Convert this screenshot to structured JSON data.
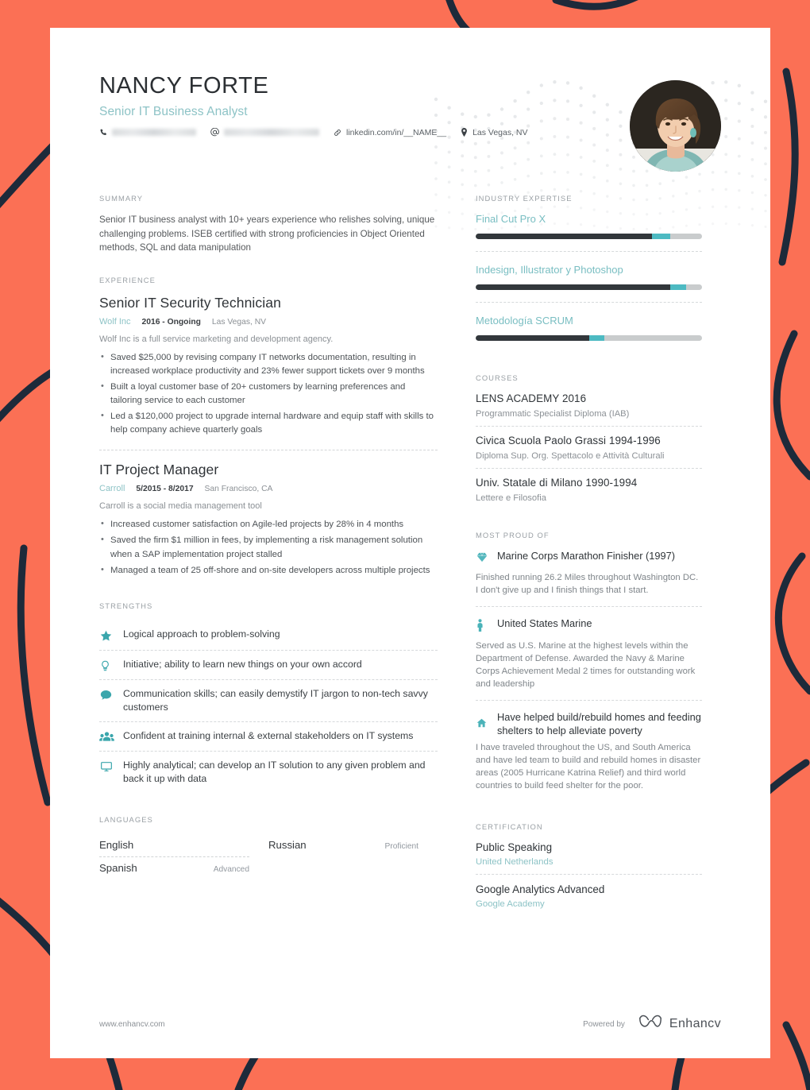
{
  "theme": {
    "page_bg": "#fb7055",
    "paper": "#ffffff",
    "teal": "#8dc3c6",
    "icon_teal": "#3aa6ac",
    "dark": "#32373b",
    "bar_track": "#c9cccd",
    "bar_mid": "#4dbac2"
  },
  "header": {
    "name": "NANCY FORTE",
    "role": "Senior IT Business Analyst",
    "contacts": [
      {
        "icon": "phone-icon",
        "value": "",
        "redacted": true
      },
      {
        "icon": "email-icon",
        "value": "",
        "redacted": true
      },
      {
        "icon": "link-icon",
        "value": "linkedin.com/in/__NAME__",
        "redacted": false
      },
      {
        "icon": "location-pin-icon",
        "value": "Las Vegas, NV",
        "redacted": false
      }
    ]
  },
  "left": {
    "summary": {
      "label": "SUMMARY",
      "text": "Senior IT business analyst with 10+ years experience who relishes solving, unique challenging problems. ISEB certified with strong proficiencies in Object Oriented methods, SQL and data manipulation"
    },
    "experience": {
      "label": "EXPERIENCE",
      "jobs": [
        {
          "title": "Senior IT Security Technician",
          "company": "Wolf Inc",
          "dates": "2016 - Ongoing",
          "location": "Las Vegas, NV",
          "description": "Wolf Inc is a full service marketing and development agency.",
          "bullets": [
            "Saved $25,000 by revising company IT networks documentation, resulting in increased workplace productivity and 23% fewer support tickets over 9 months",
            "Built a loyal customer base of 20+ customers by learning preferences and tailoring service to each customer",
            "Led a $120,000 project to upgrade internal hardware and equip staff with skills to help company achieve quarterly goals"
          ]
        },
        {
          "title": "IT Project Manager",
          "company": "Carroll",
          "dates": "5/2015 - 8/2017",
          "location": "San Francisco, CA",
          "description": "Carroll is a social media management tool",
          "bullets": [
            "Increased customer satisfaction on Agile-led projects by 28% in 4 months",
            "Saved the firm $1 million in fees, by implementing a risk management solution when a SAP implementation project stalled",
            "Managed a team of 25 off-shore and on-site developers across multiple projects"
          ]
        }
      ]
    },
    "strengths": {
      "label": "STRENGTHS",
      "items": [
        {
          "icon": "star-icon",
          "text": "Logical approach to problem-solving"
        },
        {
          "icon": "lightbulb-icon",
          "text": "Initiative; ability to learn new things on your own accord"
        },
        {
          "icon": "chat-bubble-icon",
          "text": "Communication skills; can easily demystify IT jargon to non-tech savvy customers"
        },
        {
          "icon": "people-group-icon",
          "text": "Confident at training internal & external stakeholders on IT systems"
        },
        {
          "icon": "monitor-icon",
          "text": "Highly analytical; can develop an IT solution to any given problem and back it up with data"
        }
      ]
    },
    "languages": {
      "label": "LANGUAGES",
      "items": [
        {
          "name": "English",
          "level": ""
        },
        {
          "name": "Spanish",
          "level": "Advanced"
        },
        {
          "name": "Russian",
          "level": "Proficient"
        }
      ]
    }
  },
  "right": {
    "industry_expertise": {
      "label": "INDUSTRY EXPERTISE",
      "skills": [
        {
          "name": "Final Cut Pro X",
          "dark_pct": 78,
          "mid_pct": 8
        },
        {
          "name": "Indesign, Illustrator y Photoshop",
          "dark_pct": 86,
          "mid_pct": 7
        },
        {
          "name": "Metodología SCRUM",
          "dark_pct": 50,
          "mid_pct": 7
        }
      ]
    },
    "courses": {
      "label": "COURSES",
      "items": [
        {
          "name": "LENS ACADEMY 2016",
          "sub": "Programmatic Specialist Diploma (IAB)"
        },
        {
          "name": "Civica Scuola Paolo Grassi 1994-1996",
          "sub": "Diploma Sup. Org. Spettacolo e Attività Culturali"
        },
        {
          "name": "Univ. Statale di Milano 1990-1994",
          "sub": "Lettere e Filosofia"
        }
      ]
    },
    "most_proud_of": {
      "label": "MOST PROUD OF",
      "items": [
        {
          "icon": "diamond-icon",
          "title": "Marine Corps Marathon Finisher (1997)",
          "text": "Finished running 26.2 Miles throughout Washington DC. I don't give up and I finish things that I start."
        },
        {
          "icon": "person-icon",
          "title": "United States Marine",
          "text": "Served as U.S. Marine at the highest levels within the Department of Defense. Awarded the Navy & Marine Corps Achievement Medal 2 times for outstanding work and leadership"
        },
        {
          "icon": "home-icon",
          "title": "Have helped build/rebuild homes and feeding shelters to help alleviate poverty",
          "text": "I have traveled throughout the US, and South America and have led team to build and rebuild homes in disaster areas (2005 Hurricane Katrina Relief) and third world countries to build feed shelter for the poor."
        }
      ]
    },
    "certification": {
      "label": "CERTIFICATION",
      "items": [
        {
          "name": "Public Speaking",
          "issuer": "United Netherlands"
        },
        {
          "name": "Google Analytics Advanced",
          "issuer": "Google Academy"
        }
      ]
    }
  },
  "footer": {
    "site": "www.enhancv.com",
    "powered_by": "Powered by",
    "brand": "Enhancv"
  }
}
